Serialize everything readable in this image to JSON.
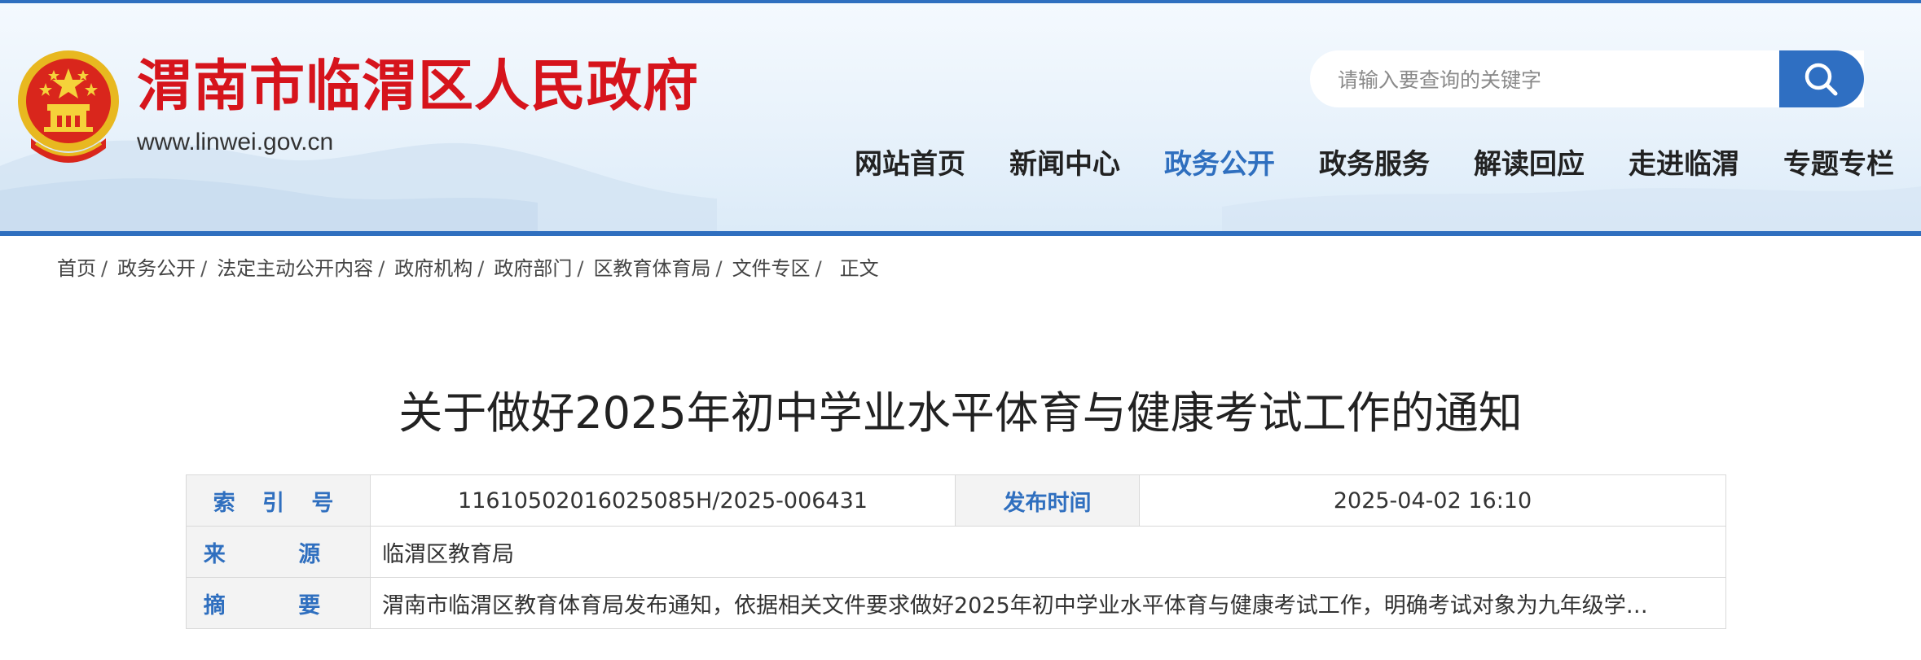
{
  "header": {
    "site_title": "渭南市临渭区人民政府",
    "site_url": "www.linwei.gov.cn",
    "emblem_icon": "national-emblem-icon",
    "colors": {
      "title": "#d6141c",
      "accent": "#2f6fbf"
    }
  },
  "search": {
    "placeholder": "请输入要查询的关键字",
    "button_icon": "search-icon"
  },
  "nav": {
    "items": [
      {
        "label": "网站首页",
        "active": false
      },
      {
        "label": "新闻中心",
        "active": false
      },
      {
        "label": "政务公开",
        "active": true
      },
      {
        "label": "政务服务",
        "active": false
      },
      {
        "label": "解读回应",
        "active": false
      },
      {
        "label": "走进临渭",
        "active": false
      },
      {
        "label": "专题专栏",
        "active": false
      }
    ]
  },
  "breadcrumb": {
    "items": [
      "首页",
      "政务公开",
      "法定主动公开内容",
      "政府机构",
      "政府部门",
      "区教育体育局",
      "文件专区"
    ],
    "separator": "/",
    "current": "正文"
  },
  "article": {
    "title": "关于做好2025年初中学业水平体育与健康考试工作的通知"
  },
  "meta": {
    "index_label": "索 引 号",
    "index_value": "11610502016025085H/2025-006431",
    "publish_label": "发布时间",
    "publish_value": "2025-04-02 16:10",
    "source_label": "来 源",
    "source_value": "临渭区教育局",
    "summary_label": "摘 要",
    "summary_value": "渭南市临渭区教育体育局发布通知，依据相关文件要求做好2025年初中学业水平体育与健康考试工作，明确考试对象为九年级学生…"
  }
}
